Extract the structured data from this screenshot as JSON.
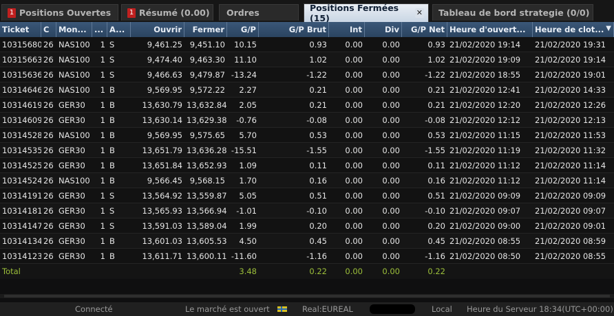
{
  "tabs": [
    {
      "label": "Positions Ouvertes",
      "badge": "1"
    },
    {
      "label": "Résumé (0.00)",
      "badge": "1"
    },
    {
      "label": "Ordres"
    },
    {
      "label": "Positions Fermées (15)",
      "close": "✕"
    },
    {
      "label": "Tableau de bord strategie (0/0)"
    }
  ],
  "columns": [
    "Ticket",
    "C",
    "Mon...",
    "...",
    "A...",
    "Ouvrir",
    "Fermer",
    "G/P",
    "G/P Brut",
    "Int",
    "Div",
    "G/P Net",
    "Heure d'ouvert...",
    "Heure de clot..."
  ],
  "rows": [
    [
      "10315680",
      "26",
      "NAS100",
      "1",
      "S",
      "9,461.25",
      "9,451.10",
      "10.15",
      "0.93",
      "0.00",
      "0.00",
      "0.93",
      "21/02/2020 19:14",
      "21/02/2020 19:31"
    ],
    [
      "10315663",
      "26",
      "NAS100",
      "1",
      "S",
      "9,474.40",
      "9,463.30",
      "11.10",
      "1.02",
      "0.00",
      "0.00",
      "1.02",
      "21/02/2020 19:09",
      "21/02/2020 19:14"
    ],
    [
      "10315636",
      "26",
      "NAS100",
      "1",
      "S",
      "9,466.63",
      "9,479.87",
      "-13.24",
      "-1.22",
      "0.00",
      "0.00",
      "-1.22",
      "21/02/2020 18:55",
      "21/02/2020 19:01"
    ],
    [
      "10314646",
      "26",
      "NAS100",
      "1",
      "B",
      "9,569.95",
      "9,572.22",
      "2.27",
      "0.21",
      "0.00",
      "0.00",
      "0.21",
      "21/02/2020 12:41",
      "21/02/2020 14:33"
    ],
    [
      "10314619",
      "26",
      "GER30",
      "1",
      "B",
      "13,630.79",
      "13,632.84",
      "2.05",
      "0.21",
      "0.00",
      "0.00",
      "0.21",
      "21/02/2020 12:20",
      "21/02/2020 12:26"
    ],
    [
      "10314609",
      "26",
      "GER30",
      "1",
      "B",
      "13,630.14",
      "13,629.38",
      "-0.76",
      "-0.08",
      "0.00",
      "0.00",
      "-0.08",
      "21/02/2020 12:12",
      "21/02/2020 12:13"
    ],
    [
      "10314528",
      "26",
      "NAS100",
      "1",
      "B",
      "9,569.95",
      "9,575.65",
      "5.70",
      "0.53",
      "0.00",
      "0.00",
      "0.53",
      "21/02/2020 11:15",
      "21/02/2020 11:53"
    ],
    [
      "10314535",
      "26",
      "GER30",
      "1",
      "B",
      "13,651.79",
      "13,636.28",
      "-15.51",
      "-1.55",
      "0.00",
      "0.00",
      "-1.55",
      "21/02/2020 11:19",
      "21/02/2020 11:32"
    ],
    [
      "10314525",
      "26",
      "GER30",
      "1",
      "B",
      "13,651.84",
      "13,652.93",
      "1.09",
      "0.11",
      "0.00",
      "0.00",
      "0.11",
      "21/02/2020 11:12",
      "21/02/2020 11:14"
    ],
    [
      "10314524",
      "26",
      "NAS100",
      "1",
      "B",
      "9,566.45",
      "9,568.15",
      "1.70",
      "0.16",
      "0.00",
      "0.00",
      "0.16",
      "21/02/2020 11:12",
      "21/02/2020 11:14"
    ],
    [
      "10314191",
      "26",
      "GER30",
      "1",
      "S",
      "13,564.92",
      "13,559.87",
      "5.05",
      "0.51",
      "0.00",
      "0.00",
      "0.51",
      "21/02/2020 09:09",
      "21/02/2020 09:09"
    ],
    [
      "10314181",
      "26",
      "GER30",
      "1",
      "S",
      "13,565.93",
      "13,566.94",
      "-1.01",
      "-0.10",
      "0.00",
      "0.00",
      "-0.10",
      "21/02/2020 09:07",
      "21/02/2020 09:07"
    ],
    [
      "10314147",
      "26",
      "GER30",
      "1",
      "S",
      "13,591.03",
      "13,589.04",
      "1.99",
      "0.20",
      "0.00",
      "0.00",
      "0.20",
      "21/02/2020 09:00",
      "21/02/2020 09:01"
    ],
    [
      "10314134",
      "26",
      "GER30",
      "1",
      "B",
      "13,601.03",
      "13,605.53",
      "4.50",
      "0.45",
      "0.00",
      "0.00",
      "0.45",
      "21/02/2020 08:55",
      "21/02/2020 08:59"
    ],
    [
      "10314123",
      "26",
      "GER30",
      "1",
      "B",
      "13,611.71",
      "13,600.11",
      "-11.60",
      "-1.16",
      "0.00",
      "0.00",
      "-1.16",
      "21/02/2020 08:50",
      "21/02/2020 08:55"
    ]
  ],
  "total": {
    "label": "Total",
    "gp": "3.48",
    "gp_brut": "0.22",
    "int": "0.00",
    "div": "0.00",
    "gp_net": "0.22"
  },
  "status": {
    "connected": "Connecté",
    "market": "Le marché est ouvert",
    "account": "Real:EUREAL",
    "local": "Local",
    "server_time": "Heure du Serveur 18:34(UTC+00:00)"
  },
  "colors": {
    "header": "#2b4460",
    "active_tab": "#dfe7f0",
    "total_text": "#9cbf3a",
    "badge": "#c0201f"
  },
  "icons": {
    "sort": "chevron-down-icon",
    "close": "close-icon",
    "flag": "flag-icon"
  }
}
